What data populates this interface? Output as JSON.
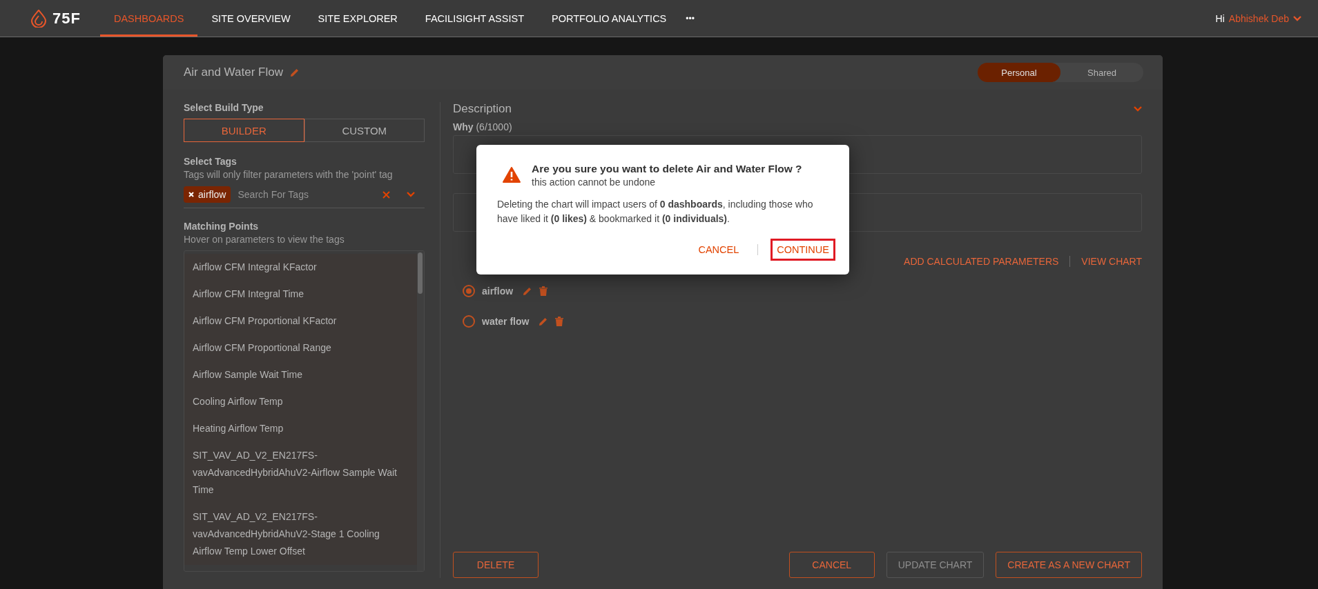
{
  "nav": {
    "logo": "75F",
    "tabs": [
      {
        "label": "DASHBOARDS",
        "selected": true
      },
      {
        "label": "SITE OVERVIEW",
        "selected": false
      },
      {
        "label": "SITE EXPLORER",
        "selected": false
      },
      {
        "label": "FACILISIGHT ASSIST",
        "selected": false
      },
      {
        "label": "PORTFOLIO ANALYTICS",
        "selected": false
      }
    ],
    "more": "•••",
    "greeting": "Hi",
    "user": "Abhishek Deb"
  },
  "editor": {
    "title": "Air and Water Flow",
    "visibility": [
      {
        "label": "Personal",
        "selected": true
      },
      {
        "label": "Shared",
        "selected": false
      }
    ],
    "build_type": {
      "label": "Select Build Type",
      "options": [
        {
          "label": "BUILDER",
          "selected": true
        },
        {
          "label": "CUSTOM",
          "selected": false
        }
      ]
    },
    "tags": {
      "label": "Select Tags",
      "hint": "Tags will only filter parameters with the 'point' tag",
      "chips": [
        "airflow"
      ],
      "placeholder": "Search For Tags"
    },
    "matching_points": {
      "label": "Matching Points",
      "hint": "Hover on parameters to view the tags",
      "items": [
        "Airflow CFM Integral KFactor",
        "Airflow CFM Integral Time",
        "Airflow CFM Proportional KFactor",
        "Airflow CFM Proportional Range",
        "Airflow Sample Wait Time",
        "Cooling Airflow Temp",
        "Heating Airflow Temp",
        "SIT_VAV_AD_V2_EN217FS-vavAdvancedHybridAhuV2-Airflow Sample Wait Time",
        "SIT_VAV_AD_V2_EN217FS-vavAdvancedHybridAhuV2-Stage 1 Cooling Airflow Temp Lower Offset"
      ]
    },
    "description": {
      "title": "Description",
      "why_label": "Why",
      "why_count": "(6/1000)"
    },
    "parameter_links": [
      "ADD CALCULATED PARAMETERS",
      "VIEW CHART"
    ],
    "parameters": [
      {
        "name": "airflow",
        "selected": true
      },
      {
        "name": "water flow",
        "selected": false
      }
    ],
    "buttons": [
      {
        "label": "DELETE",
        "disabled": false
      },
      {
        "label": "CANCEL",
        "disabled": false
      },
      {
        "label": "UPDATE CHART",
        "disabled": true
      },
      {
        "label": "CREATE AS A NEW CHART",
        "disabled": false
      }
    ]
  },
  "dialog": {
    "title": "Are you sure you want to delete Air and Water Flow ?",
    "subtitle": "this action cannot be undone",
    "body": "Deleting the chart will impact users of **0 dashboards**, including those who have liked it **(0 likes)** & bookmarked it **(0 individuals)**.",
    "buttons": [
      {
        "label": "CANCEL",
        "highlighted": false
      },
      {
        "label": "CONTINUE",
        "highlighted": true
      }
    ]
  }
}
